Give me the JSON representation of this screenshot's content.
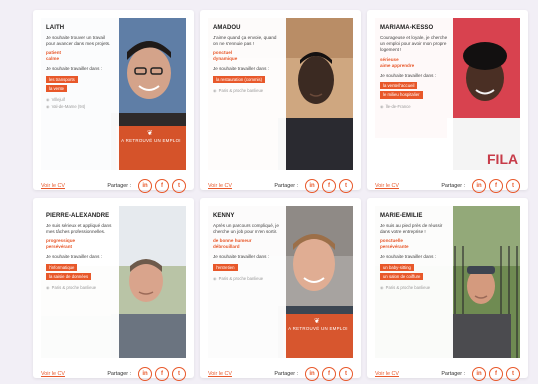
{
  "share_label": "Partager :",
  "see_cv_label": "Voir le CV",
  "social": [
    "in",
    "f",
    "t"
  ],
  "ribbon_text": "A RETROUVÉ UN EMPLOI",
  "wish_label": "Je souhaite travailler dans :",
  "cards": [
    {
      "name": "LAITH",
      "description": "Je souhaite trouver un travail pour avancer dans mes projets.",
      "qualities": [
        "patient",
        "calme"
      ],
      "tags": [
        "les transports",
        "la vente"
      ],
      "locations": [
        "Villejuif",
        "Val-de-Marne (94)"
      ],
      "hired": true
    },
    {
      "name": "AMADOU",
      "description": "J'aime quand ça envoie, quand on ne s'ennuie pas !",
      "qualities": [
        "ponctuel",
        "dynamique"
      ],
      "tags": [
        "la restauration (commis)"
      ],
      "locations": [
        "Paris & proche banlieue"
      ],
      "hired": false
    },
    {
      "name": "MARIAMA-KESSO",
      "description": "Courageuse et loyale, je cherche un emploi pour avoir mon propre logement !",
      "qualities": [
        "sérieuse",
        "aime apprendre"
      ],
      "tags": [
        "la vente/l'accueil",
        "le milieu hospitalier"
      ],
      "locations": [
        "Île-de-France"
      ],
      "hired": false
    },
    {
      "name": "PIERRE-ALEXANDRE",
      "description": "Je suis sérieux et appliqué dans mes tâches professionnelles.",
      "qualities": [
        "progressique",
        "persévérant"
      ],
      "tags": [
        "l'informatique",
        "la saisie de données"
      ],
      "locations": [
        "Paris & proche banlieue"
      ],
      "hired": false
    },
    {
      "name": "KENNY",
      "description": "Après un parcours compliqué, je cherche un job pour m'en sortir.",
      "qualities": [
        "de bonne humeur",
        "débrouillard"
      ],
      "tags": [
        "l'entretien"
      ],
      "locations": [
        "Paris & proche banlieue"
      ],
      "hired": true
    },
    {
      "name": "MARIE-EMILIE",
      "description": "Je suis au pied près de réussir dans votre entreprise !",
      "qualities": [
        "ponctuelle",
        "persévérante"
      ],
      "tags": [
        "un baby-sitting",
        "un salon de coiffure"
      ],
      "locations": [
        "Paris & proche banlieue"
      ],
      "hired": false
    }
  ],
  "colors": {
    "accent": "#e8582a",
    "background": "#f2eff6",
    "card": "#ffffff"
  },
  "icons": {
    "location": "location-pin-icon",
    "hired": "flame-logo-icon"
  }
}
